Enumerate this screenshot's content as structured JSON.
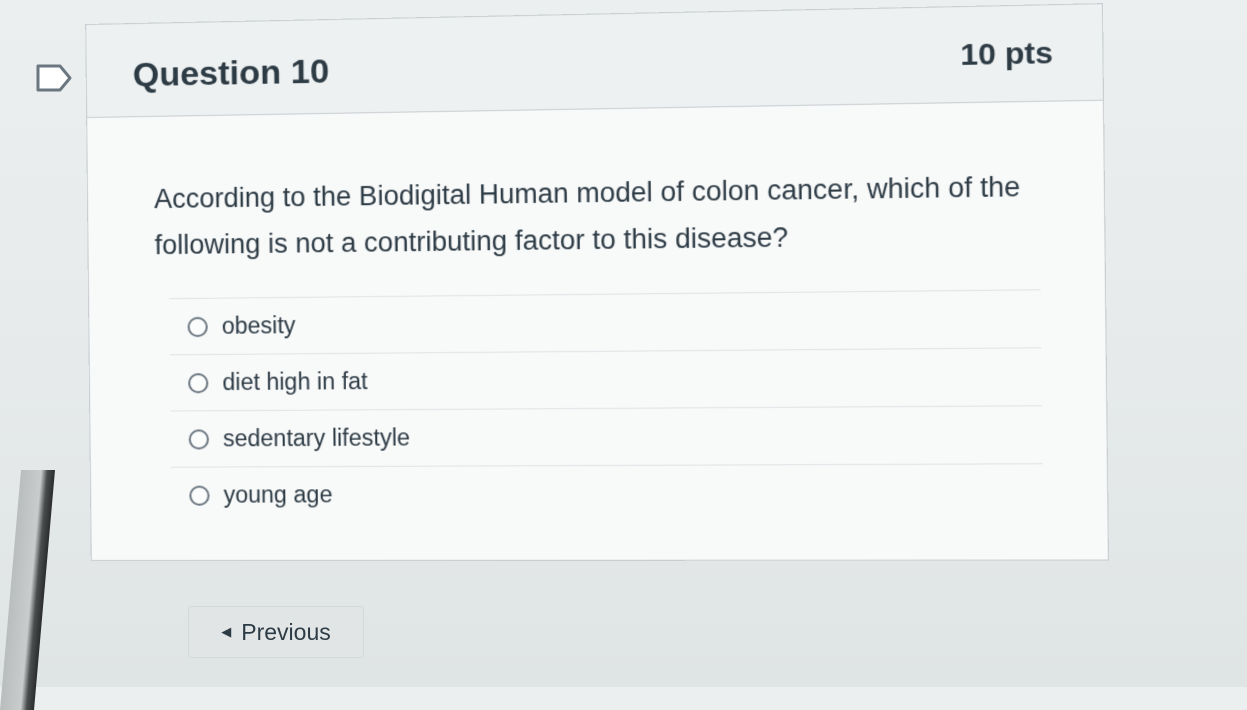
{
  "question": {
    "title": "Question 10",
    "points": "10 pts",
    "text": "According to the Biodigital Human model of colon cancer, which of the following is not a contributing factor to this disease?",
    "answers": [
      {
        "label": "obesity"
      },
      {
        "label": "diet high in fat"
      },
      {
        "label": "sedentary lifestyle"
      },
      {
        "label": "young age"
      }
    ]
  },
  "nav": {
    "previous_label": "Previous",
    "previous_icon": "caret-left-icon"
  },
  "icons": {
    "flag": "flag-question-icon"
  }
}
